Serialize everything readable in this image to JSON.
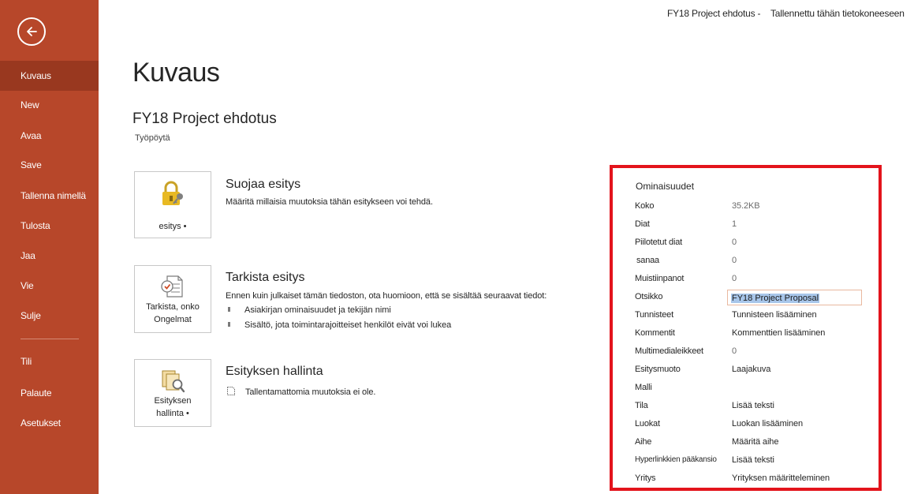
{
  "sidebar": {
    "items": [
      {
        "label": "Kuvaus",
        "active": true
      },
      {
        "label": "New"
      },
      {
        "label": "Avaa"
      },
      {
        "label": "Save"
      },
      {
        "label": "Tallenna nimellä"
      },
      {
        "label": "Tulosta"
      },
      {
        "label": "Jaa"
      },
      {
        "label": "Vie"
      },
      {
        "label": "Sulje"
      },
      {
        "label": "Tili"
      },
      {
        "label": "Palaute"
      },
      {
        "label": "Asetukset"
      }
    ],
    "back_icon": "back-arrow-icon",
    "color": "#b7472a",
    "active_color": "#99381f"
  },
  "topbar": {
    "doc_name": "FY18 Project ehdotus -",
    "save_status": "Tallennettu tähän tietokoneeseen"
  },
  "main": {
    "page_title": "Kuvaus",
    "doc_title": "FY18 Project ehdotus",
    "doc_location": "Työpöytä",
    "protect": {
      "tile_label": "esitys •",
      "title": "Suojaa esitys",
      "description": "Määritä millaisia muutoksia tähän esitykseen voi tehdä.",
      "icon": "lock-key-icon"
    },
    "inspect": {
      "tile_label_1": "Tarkista, onko",
      "tile_label_2": "Ongelmat",
      "title": "Tarkista esitys",
      "description": "Ennen kuin julkaiset tämän tiedoston, ota huomioon, että se sisältää seuraavat tiedot:",
      "bullets": [
        "Asiakirjan ominaisuudet ja tekijän nimi",
        "Sisältö, jota toimintarajoitteiset henkilöt eivät voi lukea"
      ],
      "icon": "checklist-icon"
    },
    "manage": {
      "tile_label_1": "Esityksen",
      "tile_label_2": "hallinta •",
      "title": "Esityksen hallinta",
      "description": "Tallentamattomia muutoksia ei ole.",
      "icon": "manage-versions-icon"
    }
  },
  "properties": {
    "heading": "Ominaisuudet",
    "highlight_color": "#e3141c",
    "rows": [
      {
        "label": "Koko",
        "value": "35.2KB"
      },
      {
        "label": "Diat",
        "value": "1"
      },
      {
        "label": "Piilotetut diat",
        "value": "0"
      },
      {
        "label": "sanaa",
        "value": "0"
      },
      {
        "label": "Muistiinpanot",
        "value": "0"
      },
      {
        "label": "Otsikko",
        "value": "FY18 Project Proposal"
      },
      {
        "label": "Tunnisteet",
        "value": "Tunnisteen lisääminen"
      },
      {
        "label": "Kommentit",
        "value": "Kommenttien lisääminen"
      },
      {
        "label": "Multimedialeikkeet",
        "value": "0"
      },
      {
        "label": "Esitysmuoto",
        "value": "Laajakuva"
      },
      {
        "label": "Malli",
        "value": ""
      },
      {
        "label": "Tila",
        "value": "Lisää teksti"
      },
      {
        "label": "Luokat",
        "value": "Luokan lisääminen"
      },
      {
        "label": "Aihe",
        "value": "Määritä aihe"
      },
      {
        "label": "Hyperlinkkien pääkansio",
        "value": "Lisää teksti"
      },
      {
        "label": "Yritys",
        "value": "Yrityksen määritteleminen"
      }
    ]
  }
}
